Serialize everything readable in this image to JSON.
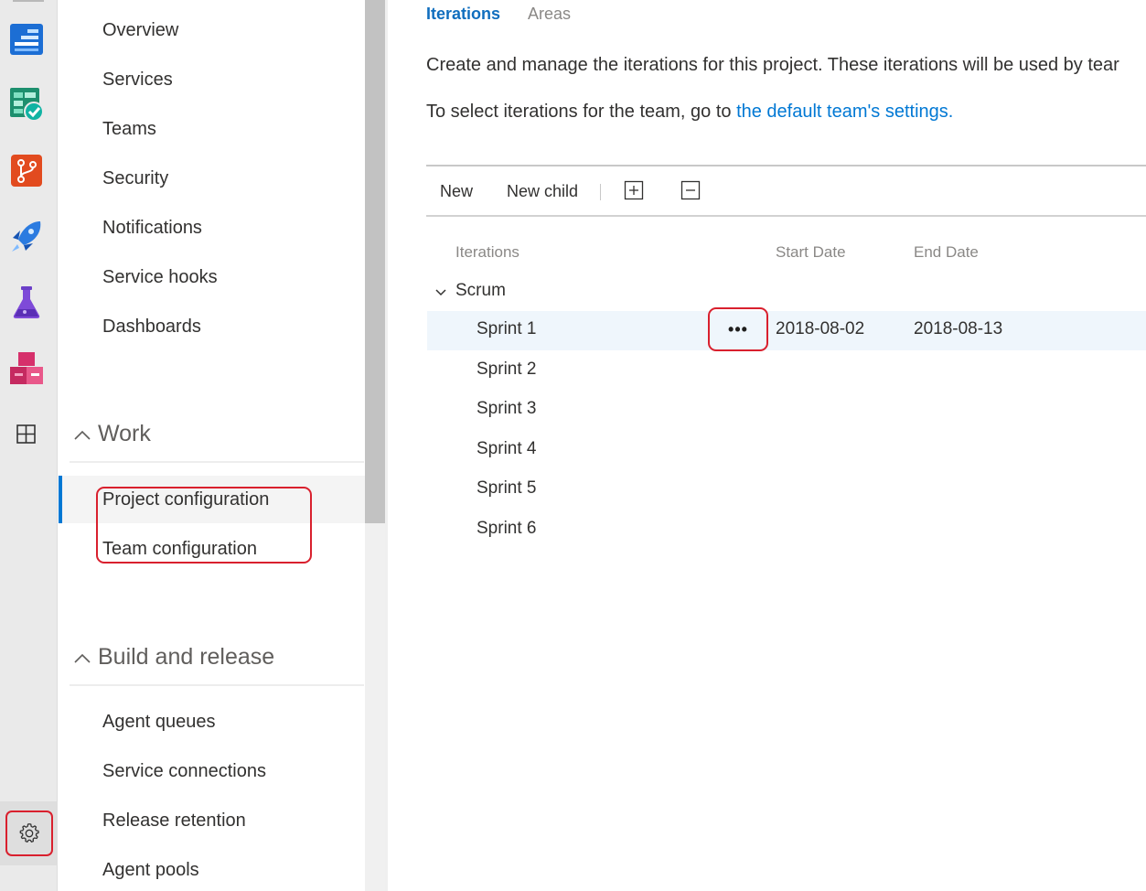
{
  "rail": {
    "icons": [
      "boards-icon",
      "work-items-icon",
      "repos-icon",
      "pipelines-icon",
      "test-plans-icon",
      "artifacts-icon",
      "grid-icon"
    ],
    "settings_icon": "gear-icon"
  },
  "nav": {
    "general_items": [
      "Overview",
      "Services",
      "Teams",
      "Security",
      "Notifications",
      "Service hooks",
      "Dashboards"
    ],
    "work_section": "Work",
    "work_items": [
      "Project configuration",
      "Team configuration"
    ],
    "build_section": "Build and release",
    "build_items": [
      "Agent queues",
      "Service connections",
      "Release retention",
      "Agent pools"
    ]
  },
  "main": {
    "tabs": [
      "Iterations",
      "Areas"
    ],
    "description": "Create and manage the iterations for this project. These iterations will be used by tear",
    "team_line_prefix": "To select iterations for the team, go to ",
    "team_line_link": "the default team's settings.",
    "toolbar": {
      "new_label": "New",
      "new_child_label": "New child",
      "expand_icon": "expand-all-icon",
      "collapse_icon": "collapse-all-icon"
    },
    "columns": [
      "Iterations",
      "Start Date",
      "End Date"
    ],
    "root": "Scrum",
    "iterations": [
      {
        "name": "Sprint 1",
        "start": "2018-08-02",
        "end": "2018-08-13"
      },
      {
        "name": "Sprint 2"
      },
      {
        "name": "Sprint 3"
      },
      {
        "name": "Sprint 4"
      },
      {
        "name": "Sprint 5"
      },
      {
        "name": "Sprint 6"
      }
    ],
    "more_actions": "•••"
  },
  "colors": {
    "accent": "#0078d4",
    "highlight_outline": "#d9202e",
    "selected_row": "#eff6fc"
  }
}
